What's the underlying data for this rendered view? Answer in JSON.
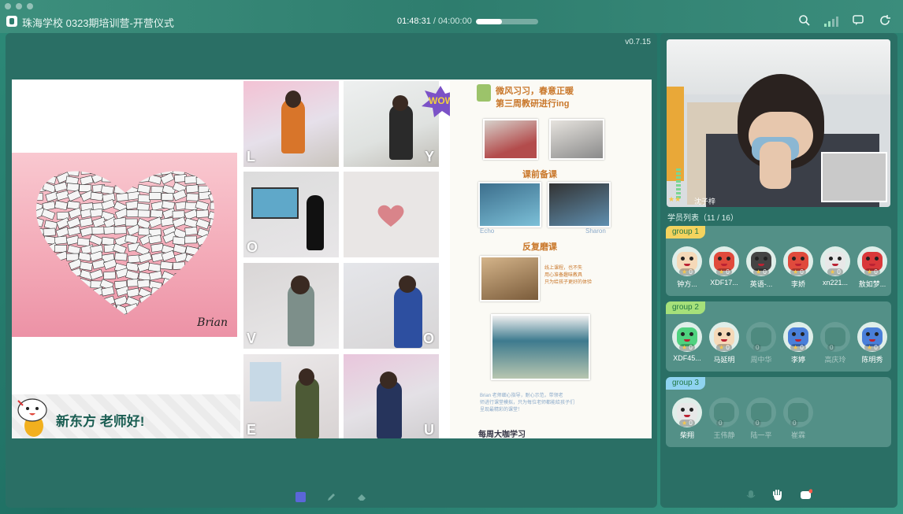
{
  "window": {
    "title": "珠海学校 0323期培训营-开营仪式"
  },
  "timer": {
    "elapsed": "01:48:31",
    "separator": " / ",
    "total": "04:00:00",
    "progress_fraction": 0.42
  },
  "top_icons": [
    "search-icon",
    "signal-icon",
    "chat-icon",
    "refresh-icon"
  ],
  "stage": {
    "version": "v0.7.15",
    "slide": {
      "slogan": "新东方 老师好!",
      "signature": "Brian",
      "letters": [
        "L",
        "Y",
        "O",
        "",
        "V",
        "O",
        "E",
        "U"
      ],
      "wow": "WOW",
      "poster": {
        "headline1": "微风习习，春意正暖",
        "headline2": "第三周教研进行ing",
        "section1": "课前备课",
        "label_echo": "Echo",
        "label_sharon": "Sharon",
        "section2": "反复磨课",
        "note1": "线上课程，也不失\n用心准备趣味教具\n只为给孩子更好的体验",
        "note2": "Brian 老师细心指导，耐心示范，带领老\n师进行课堂模拟，只为每位老师都能给孩子们\n呈现最精彩的课堂！",
        "section3": "每周大咖学习"
      }
    },
    "bottom_tools": [
      "square-icon",
      "pen-icon",
      "eraser-icon"
    ]
  },
  "camera": {
    "name": "沈子梓",
    "stars": "★★"
  },
  "roster": {
    "title": "学员列表（11 / 16）",
    "groups": [
      {
        "tag": "group 1",
        "tag_color": "#f4d35e",
        "students": [
          {
            "name": "钟方...",
            "stars": "0",
            "online": true,
            "face": "#f5d9b8"
          },
          {
            "name": "XDF17...",
            "stars": "0",
            "online": true,
            "face": "#e04a3c"
          },
          {
            "name": "英语-...",
            "stars": "0",
            "online": true,
            "face": "#444"
          },
          {
            "name": "李娇",
            "stars": "0",
            "online": true,
            "face": "#e04a3c"
          },
          {
            "name": "xn221...",
            "stars": "0",
            "online": true,
            "face": "#e8e8e8"
          },
          {
            "name": "敖如梦...",
            "stars": "0",
            "online": true,
            "face": "#d9383a"
          }
        ]
      },
      {
        "tag": "group 2",
        "tag_color": "#a6e07a",
        "students": [
          {
            "name": "XDF45...",
            "stars": "0",
            "online": true,
            "face": "#4fd27f"
          },
          {
            "name": "马延明",
            "stars": "0",
            "online": true,
            "face": "#f5d9b8"
          },
          {
            "name": "周中华",
            "stars": "0",
            "online": false,
            "face": "#3d7d72"
          },
          {
            "name": "李婷",
            "stars": "0",
            "online": true,
            "face": "#4a7fd9"
          },
          {
            "name": "高庆玲",
            "stars": "0",
            "online": false,
            "face": "#3d7d72"
          },
          {
            "name": "陈明秀",
            "stars": "0",
            "online": true,
            "face": "#4a7fd9"
          }
        ]
      },
      {
        "tag": "group 3",
        "tag_color": "#8fd3f0",
        "students": [
          {
            "name": "柴翔",
            "stars": "0",
            "online": true,
            "face": "#e8e8e8"
          },
          {
            "name": "王伟静",
            "stars": "0",
            "online": false,
            "face": "#3d7d72"
          },
          {
            "name": "陆一平",
            "stars": "0",
            "online": false,
            "face": "#3d7d72"
          },
          {
            "name": "崔霖",
            "stars": "0",
            "online": false,
            "face": "#3d7d72"
          }
        ]
      }
    ]
  },
  "side_tools": [
    "mic-icon",
    "raise-hand-icon",
    "chat-bubble-icon"
  ]
}
